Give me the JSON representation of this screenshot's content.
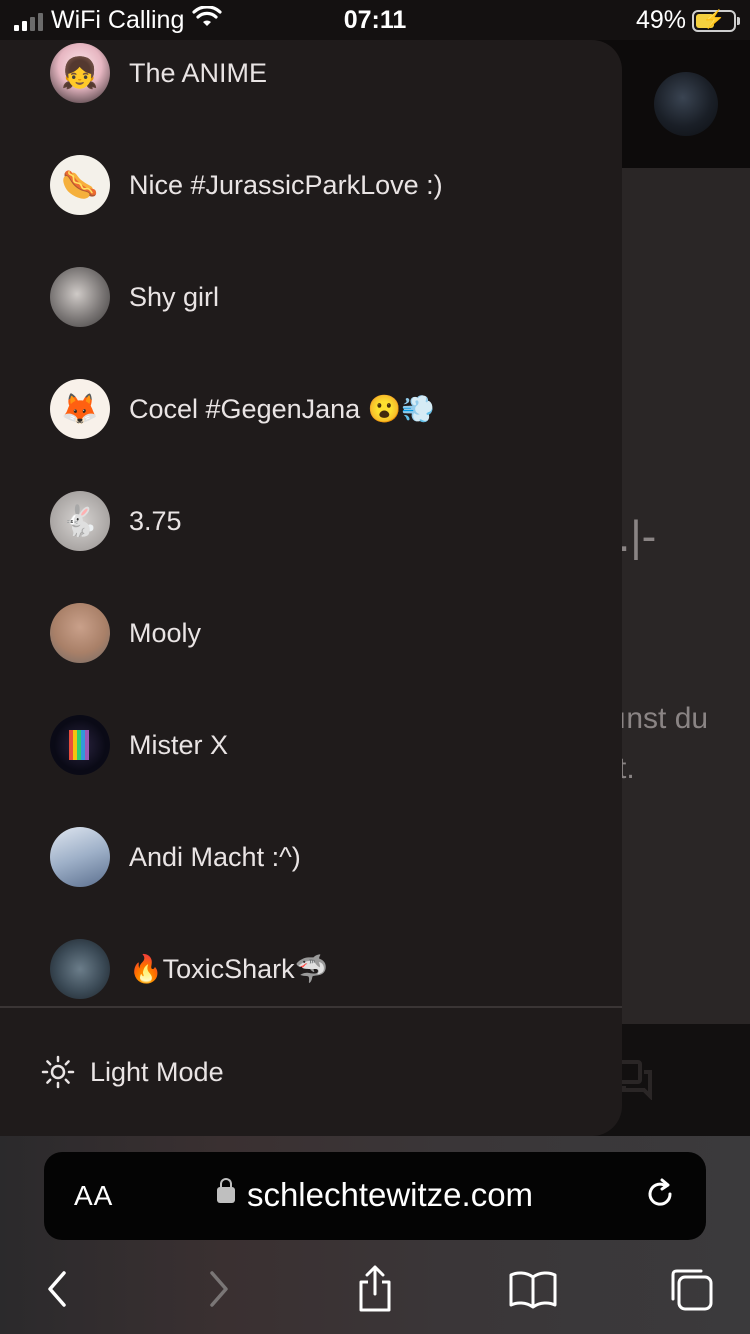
{
  "status_bar": {
    "carrier": "WiFi Calling",
    "time": "07:11",
    "battery": "49%",
    "battery_level": 0.49
  },
  "background_page": {
    "fragment_1": ".|-",
    "fragment_2": "ınst du",
    "fragment_3": "t."
  },
  "drawer": {
    "items": [
      {
        "label": "The ANIME",
        "icon": "anime-girl-avatar",
        "color": "#f3d6dc"
      },
      {
        "label": "Nice #JurassicParkLove :)",
        "icon": "hotdog-avatar",
        "color": "#f4f1ea"
      },
      {
        "label": "Shy girl",
        "icon": "grey-photo-avatar",
        "color": "#8f8c8b"
      },
      {
        "label": "Cocel #GegenJana 😮💨",
        "icon": "red-panda-avatar",
        "color": "#f8f1ea"
      },
      {
        "label": "3.75",
        "icon": "rabbit-sketch-avatar",
        "color": "#bdbab8"
      },
      {
        "label": "Mooly",
        "icon": "diglett-avatar",
        "color": "#c49a82"
      },
      {
        "label": "Mister X",
        "icon": "rainbow-avatar",
        "color": "#0a0a16"
      },
      {
        "label": "Andi Macht :^)",
        "icon": "bird-photo-avatar",
        "color": "#9eb0c8"
      },
      {
        "label": "🔥ToxicShark🦈",
        "icon": "creature-photo-avatar",
        "color": "#3b4a56"
      }
    ],
    "light_mode_label": "Light Mode"
  },
  "browser": {
    "text_size_label": "AA",
    "url": "schlechtewitze.com"
  }
}
